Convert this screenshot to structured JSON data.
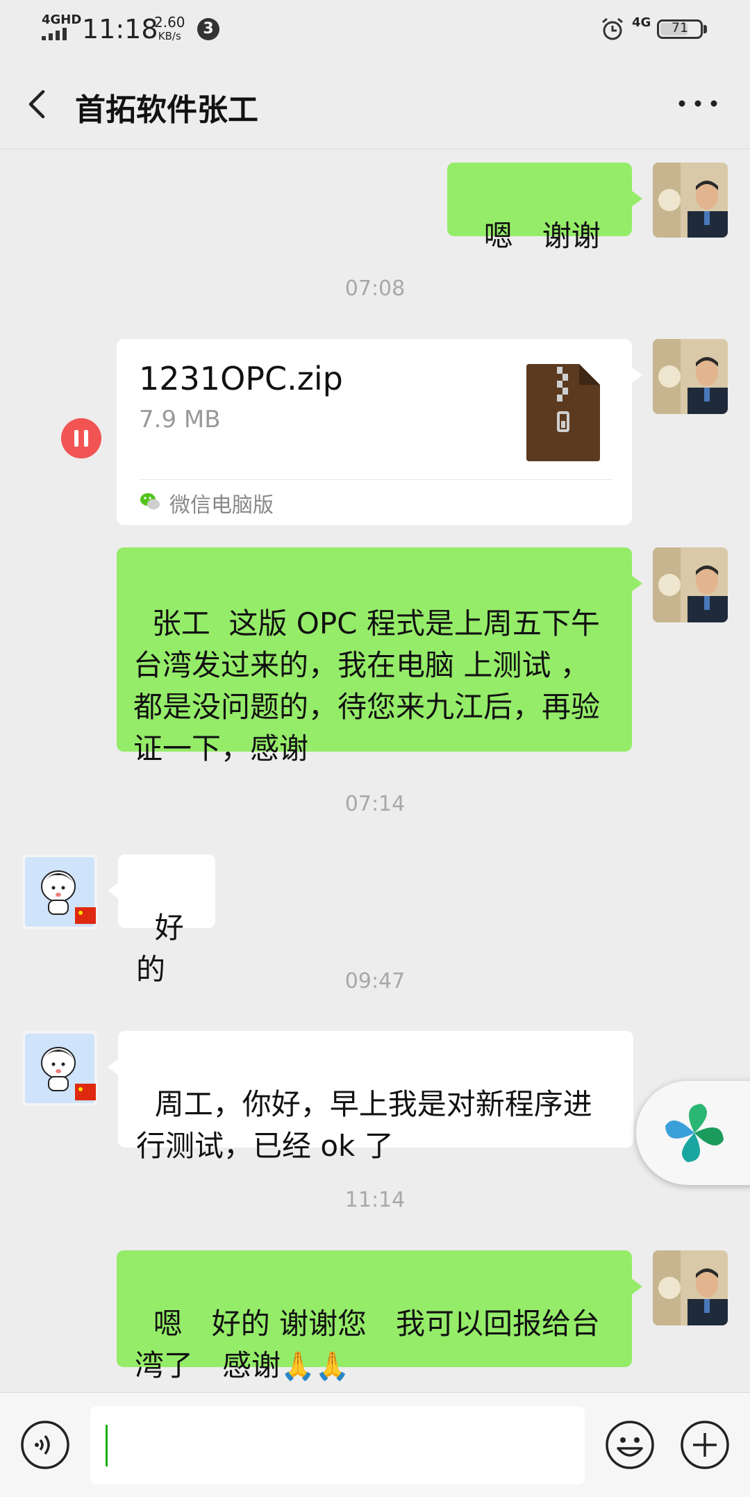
{
  "status_bar": {
    "network_label": "4GHD",
    "time": "11:18",
    "speed_value": "2.60",
    "speed_unit": "KB/s",
    "notification_count": "3",
    "network_type": "4G",
    "battery": "71",
    "battery_level_percent": 71
  },
  "header": {
    "title": "首拓软件张工"
  },
  "messages": {
    "m1": {
      "text": "嗯　谢谢"
    },
    "t1": "07:08",
    "file": {
      "name": "1231OPC.zip",
      "size": "7.9 MB",
      "source": "微信电脑版"
    },
    "m3": {
      "text": "张工  这版 OPC 程式是上周五下午台湾发过来的，我在电脑 上测试 ，都是没问题的，待您来九江后，再验证一下，感谢"
    },
    "t2": "07:14",
    "m4": {
      "text": "好的"
    },
    "t3": "09:47",
    "m5": {
      "text": "周工，你好，早上我是对新程序进行测试，已经 ok 了"
    },
    "t4": "11:14",
    "m6": {
      "text": "嗯　好的 谢谢您　我可以回报给台湾了　感谢",
      "emoji": "🙏🙏"
    }
  },
  "input": {
    "value": ""
  },
  "colors": {
    "outgoing_bubble": "#95ec69",
    "incoming_bubble": "#ffffff",
    "background": "#ededed",
    "pause_button": "#f25454"
  },
  "icons": {
    "back": "chevron-left-icon",
    "more": "more-dots-icon",
    "voice": "voice-icon",
    "emoji": "emoji-icon",
    "plus": "plus-icon",
    "file": "zip-file-icon"
  }
}
